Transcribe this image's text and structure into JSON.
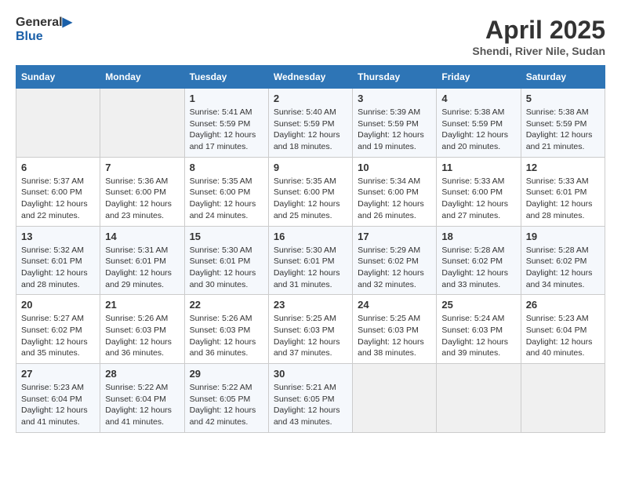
{
  "header": {
    "logo_general": "General",
    "logo_blue": "Blue",
    "title": "April 2025",
    "subtitle": "Shendi, River Nile, Sudan"
  },
  "weekdays": [
    "Sunday",
    "Monday",
    "Tuesday",
    "Wednesday",
    "Thursday",
    "Friday",
    "Saturday"
  ],
  "weeks": [
    [
      {
        "day": "",
        "sunrise": "",
        "sunset": "",
        "daylight": ""
      },
      {
        "day": "",
        "sunrise": "",
        "sunset": "",
        "daylight": ""
      },
      {
        "day": "1",
        "sunrise": "Sunrise: 5:41 AM",
        "sunset": "Sunset: 5:59 PM",
        "daylight": "Daylight: 12 hours and 17 minutes."
      },
      {
        "day": "2",
        "sunrise": "Sunrise: 5:40 AM",
        "sunset": "Sunset: 5:59 PM",
        "daylight": "Daylight: 12 hours and 18 minutes."
      },
      {
        "day": "3",
        "sunrise": "Sunrise: 5:39 AM",
        "sunset": "Sunset: 5:59 PM",
        "daylight": "Daylight: 12 hours and 19 minutes."
      },
      {
        "day": "4",
        "sunrise": "Sunrise: 5:38 AM",
        "sunset": "Sunset: 5:59 PM",
        "daylight": "Daylight: 12 hours and 20 minutes."
      },
      {
        "day": "5",
        "sunrise": "Sunrise: 5:38 AM",
        "sunset": "Sunset: 5:59 PM",
        "daylight": "Daylight: 12 hours and 21 minutes."
      }
    ],
    [
      {
        "day": "6",
        "sunrise": "Sunrise: 5:37 AM",
        "sunset": "Sunset: 6:00 PM",
        "daylight": "Daylight: 12 hours and 22 minutes."
      },
      {
        "day": "7",
        "sunrise": "Sunrise: 5:36 AM",
        "sunset": "Sunset: 6:00 PM",
        "daylight": "Daylight: 12 hours and 23 minutes."
      },
      {
        "day": "8",
        "sunrise": "Sunrise: 5:35 AM",
        "sunset": "Sunset: 6:00 PM",
        "daylight": "Daylight: 12 hours and 24 minutes."
      },
      {
        "day": "9",
        "sunrise": "Sunrise: 5:35 AM",
        "sunset": "Sunset: 6:00 PM",
        "daylight": "Daylight: 12 hours and 25 minutes."
      },
      {
        "day": "10",
        "sunrise": "Sunrise: 5:34 AM",
        "sunset": "Sunset: 6:00 PM",
        "daylight": "Daylight: 12 hours and 26 minutes."
      },
      {
        "day": "11",
        "sunrise": "Sunrise: 5:33 AM",
        "sunset": "Sunset: 6:00 PM",
        "daylight": "Daylight: 12 hours and 27 minutes."
      },
      {
        "day": "12",
        "sunrise": "Sunrise: 5:33 AM",
        "sunset": "Sunset: 6:01 PM",
        "daylight": "Daylight: 12 hours and 28 minutes."
      }
    ],
    [
      {
        "day": "13",
        "sunrise": "Sunrise: 5:32 AM",
        "sunset": "Sunset: 6:01 PM",
        "daylight": "Daylight: 12 hours and 28 minutes."
      },
      {
        "day": "14",
        "sunrise": "Sunrise: 5:31 AM",
        "sunset": "Sunset: 6:01 PM",
        "daylight": "Daylight: 12 hours and 29 minutes."
      },
      {
        "day": "15",
        "sunrise": "Sunrise: 5:30 AM",
        "sunset": "Sunset: 6:01 PM",
        "daylight": "Daylight: 12 hours and 30 minutes."
      },
      {
        "day": "16",
        "sunrise": "Sunrise: 5:30 AM",
        "sunset": "Sunset: 6:01 PM",
        "daylight": "Daylight: 12 hours and 31 minutes."
      },
      {
        "day": "17",
        "sunrise": "Sunrise: 5:29 AM",
        "sunset": "Sunset: 6:02 PM",
        "daylight": "Daylight: 12 hours and 32 minutes."
      },
      {
        "day": "18",
        "sunrise": "Sunrise: 5:28 AM",
        "sunset": "Sunset: 6:02 PM",
        "daylight": "Daylight: 12 hours and 33 minutes."
      },
      {
        "day": "19",
        "sunrise": "Sunrise: 5:28 AM",
        "sunset": "Sunset: 6:02 PM",
        "daylight": "Daylight: 12 hours and 34 minutes."
      }
    ],
    [
      {
        "day": "20",
        "sunrise": "Sunrise: 5:27 AM",
        "sunset": "Sunset: 6:02 PM",
        "daylight": "Daylight: 12 hours and 35 minutes."
      },
      {
        "day": "21",
        "sunrise": "Sunrise: 5:26 AM",
        "sunset": "Sunset: 6:03 PM",
        "daylight": "Daylight: 12 hours and 36 minutes."
      },
      {
        "day": "22",
        "sunrise": "Sunrise: 5:26 AM",
        "sunset": "Sunset: 6:03 PM",
        "daylight": "Daylight: 12 hours and 36 minutes."
      },
      {
        "day": "23",
        "sunrise": "Sunrise: 5:25 AM",
        "sunset": "Sunset: 6:03 PM",
        "daylight": "Daylight: 12 hours and 37 minutes."
      },
      {
        "day": "24",
        "sunrise": "Sunrise: 5:25 AM",
        "sunset": "Sunset: 6:03 PM",
        "daylight": "Daylight: 12 hours and 38 minutes."
      },
      {
        "day": "25",
        "sunrise": "Sunrise: 5:24 AM",
        "sunset": "Sunset: 6:03 PM",
        "daylight": "Daylight: 12 hours and 39 minutes."
      },
      {
        "day": "26",
        "sunrise": "Sunrise: 5:23 AM",
        "sunset": "Sunset: 6:04 PM",
        "daylight": "Daylight: 12 hours and 40 minutes."
      }
    ],
    [
      {
        "day": "27",
        "sunrise": "Sunrise: 5:23 AM",
        "sunset": "Sunset: 6:04 PM",
        "daylight": "Daylight: 12 hours and 41 minutes."
      },
      {
        "day": "28",
        "sunrise": "Sunrise: 5:22 AM",
        "sunset": "Sunset: 6:04 PM",
        "daylight": "Daylight: 12 hours and 41 minutes."
      },
      {
        "day": "29",
        "sunrise": "Sunrise: 5:22 AM",
        "sunset": "Sunset: 6:05 PM",
        "daylight": "Daylight: 12 hours and 42 minutes."
      },
      {
        "day": "30",
        "sunrise": "Sunrise: 5:21 AM",
        "sunset": "Sunset: 6:05 PM",
        "daylight": "Daylight: 12 hours and 43 minutes."
      },
      {
        "day": "",
        "sunrise": "",
        "sunset": "",
        "daylight": ""
      },
      {
        "day": "",
        "sunrise": "",
        "sunset": "",
        "daylight": ""
      },
      {
        "day": "",
        "sunrise": "",
        "sunset": "",
        "daylight": ""
      }
    ]
  ]
}
